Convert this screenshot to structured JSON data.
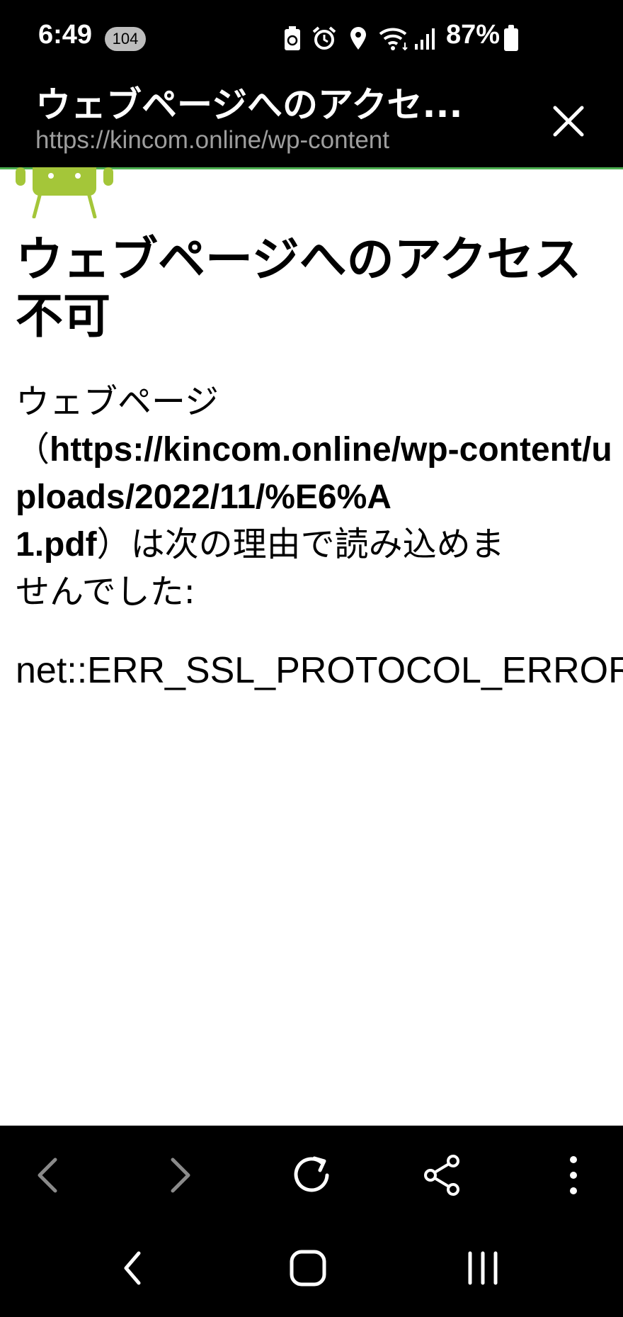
{
  "status_bar": {
    "time": "6:49",
    "notification_count": "104",
    "battery_percent": "87%",
    "icons": [
      "recycle-battery-icon",
      "alarm-icon",
      "location-icon",
      "wifi-icon",
      "signal-icon",
      "battery-icon"
    ]
  },
  "title_bar": {
    "title": "ウェブページへのアクセ...",
    "url": "https://kincom.online/wp-content"
  },
  "error_page": {
    "heading": "ウェブページへのアクセス不可",
    "desc_prefix": "ウェブページ\n（",
    "desc_url": "https://kincom.online/wp-content/uploads/2022/11/%E6%A\n1.pdf",
    "desc_suffix": "）は次の理由で読み込めま\nせんでした:",
    "error_code": "net::ERR_SSL_PROTOCOL_ERROR"
  },
  "toolbar": {
    "buttons": [
      "back-icon",
      "forward-icon",
      "reload-icon",
      "share-icon",
      "more-icon"
    ],
    "back_enabled": false,
    "forward_enabled": false
  },
  "nav_bar": {
    "buttons": [
      "nav-back-icon",
      "nav-home-icon",
      "nav-recents-icon"
    ]
  },
  "colors": {
    "accent": "#4caf50",
    "android_green": "#a4c639",
    "disabled": "#8a8a8a"
  }
}
